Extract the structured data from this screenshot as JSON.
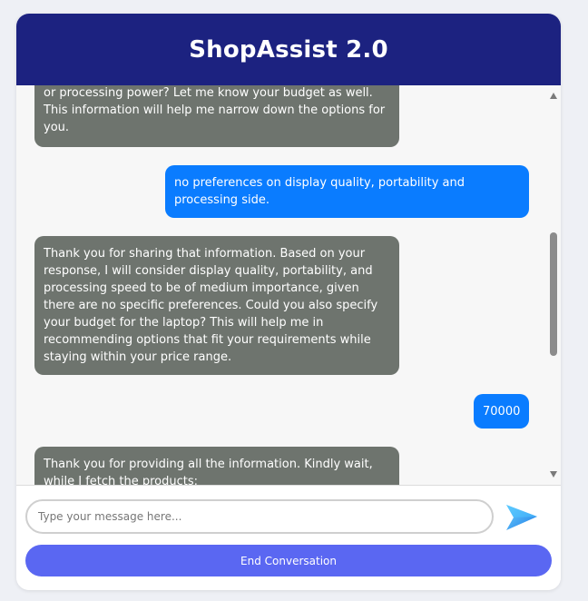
{
  "header": {
    "title": "ShopAssist 2.0"
  },
  "chat": {
    "messages": [
      {
        "role": "bot",
        "lines": [
          "or processing power? Let me know your budget as well.",
          "This information will help me narrow down the options for",
          "you."
        ]
      },
      {
        "role": "user",
        "lines": [
          "no preferences on display quality, portability and",
          "processing side."
        ]
      },
      {
        "role": "bot",
        "lines": [
          "Thank you for sharing that information. Based on your",
          "response, I will consider display quality, portability, and",
          "processing speed to be of medium importance, given",
          "there are no specific preferences. Could you also specify",
          "your budget for the laptop? This will help me in",
          "recommending options that fit your requirements while",
          "staying within your price range."
        ]
      },
      {
        "role": "user",
        "lines": [
          "70000"
        ]
      },
      {
        "role": "bot",
        "lines": [
          "Thank you for providing all the information. Kindly wait,",
          "while I fetch the products:"
        ]
      }
    ]
  },
  "input": {
    "placeholder": "Type your message here..."
  },
  "buttons": {
    "end_conversation": "End Conversation"
  },
  "icons": {
    "send": "send-arrow-icon",
    "scroll_up": "scroll-up-arrow",
    "scroll_down": "scroll-down-arrow"
  },
  "colors": {
    "header_bg": "#1c2280",
    "bot_bubble": "#6e746e",
    "user_bubble": "#0a7cff",
    "end_button": "#5a67f2"
  }
}
